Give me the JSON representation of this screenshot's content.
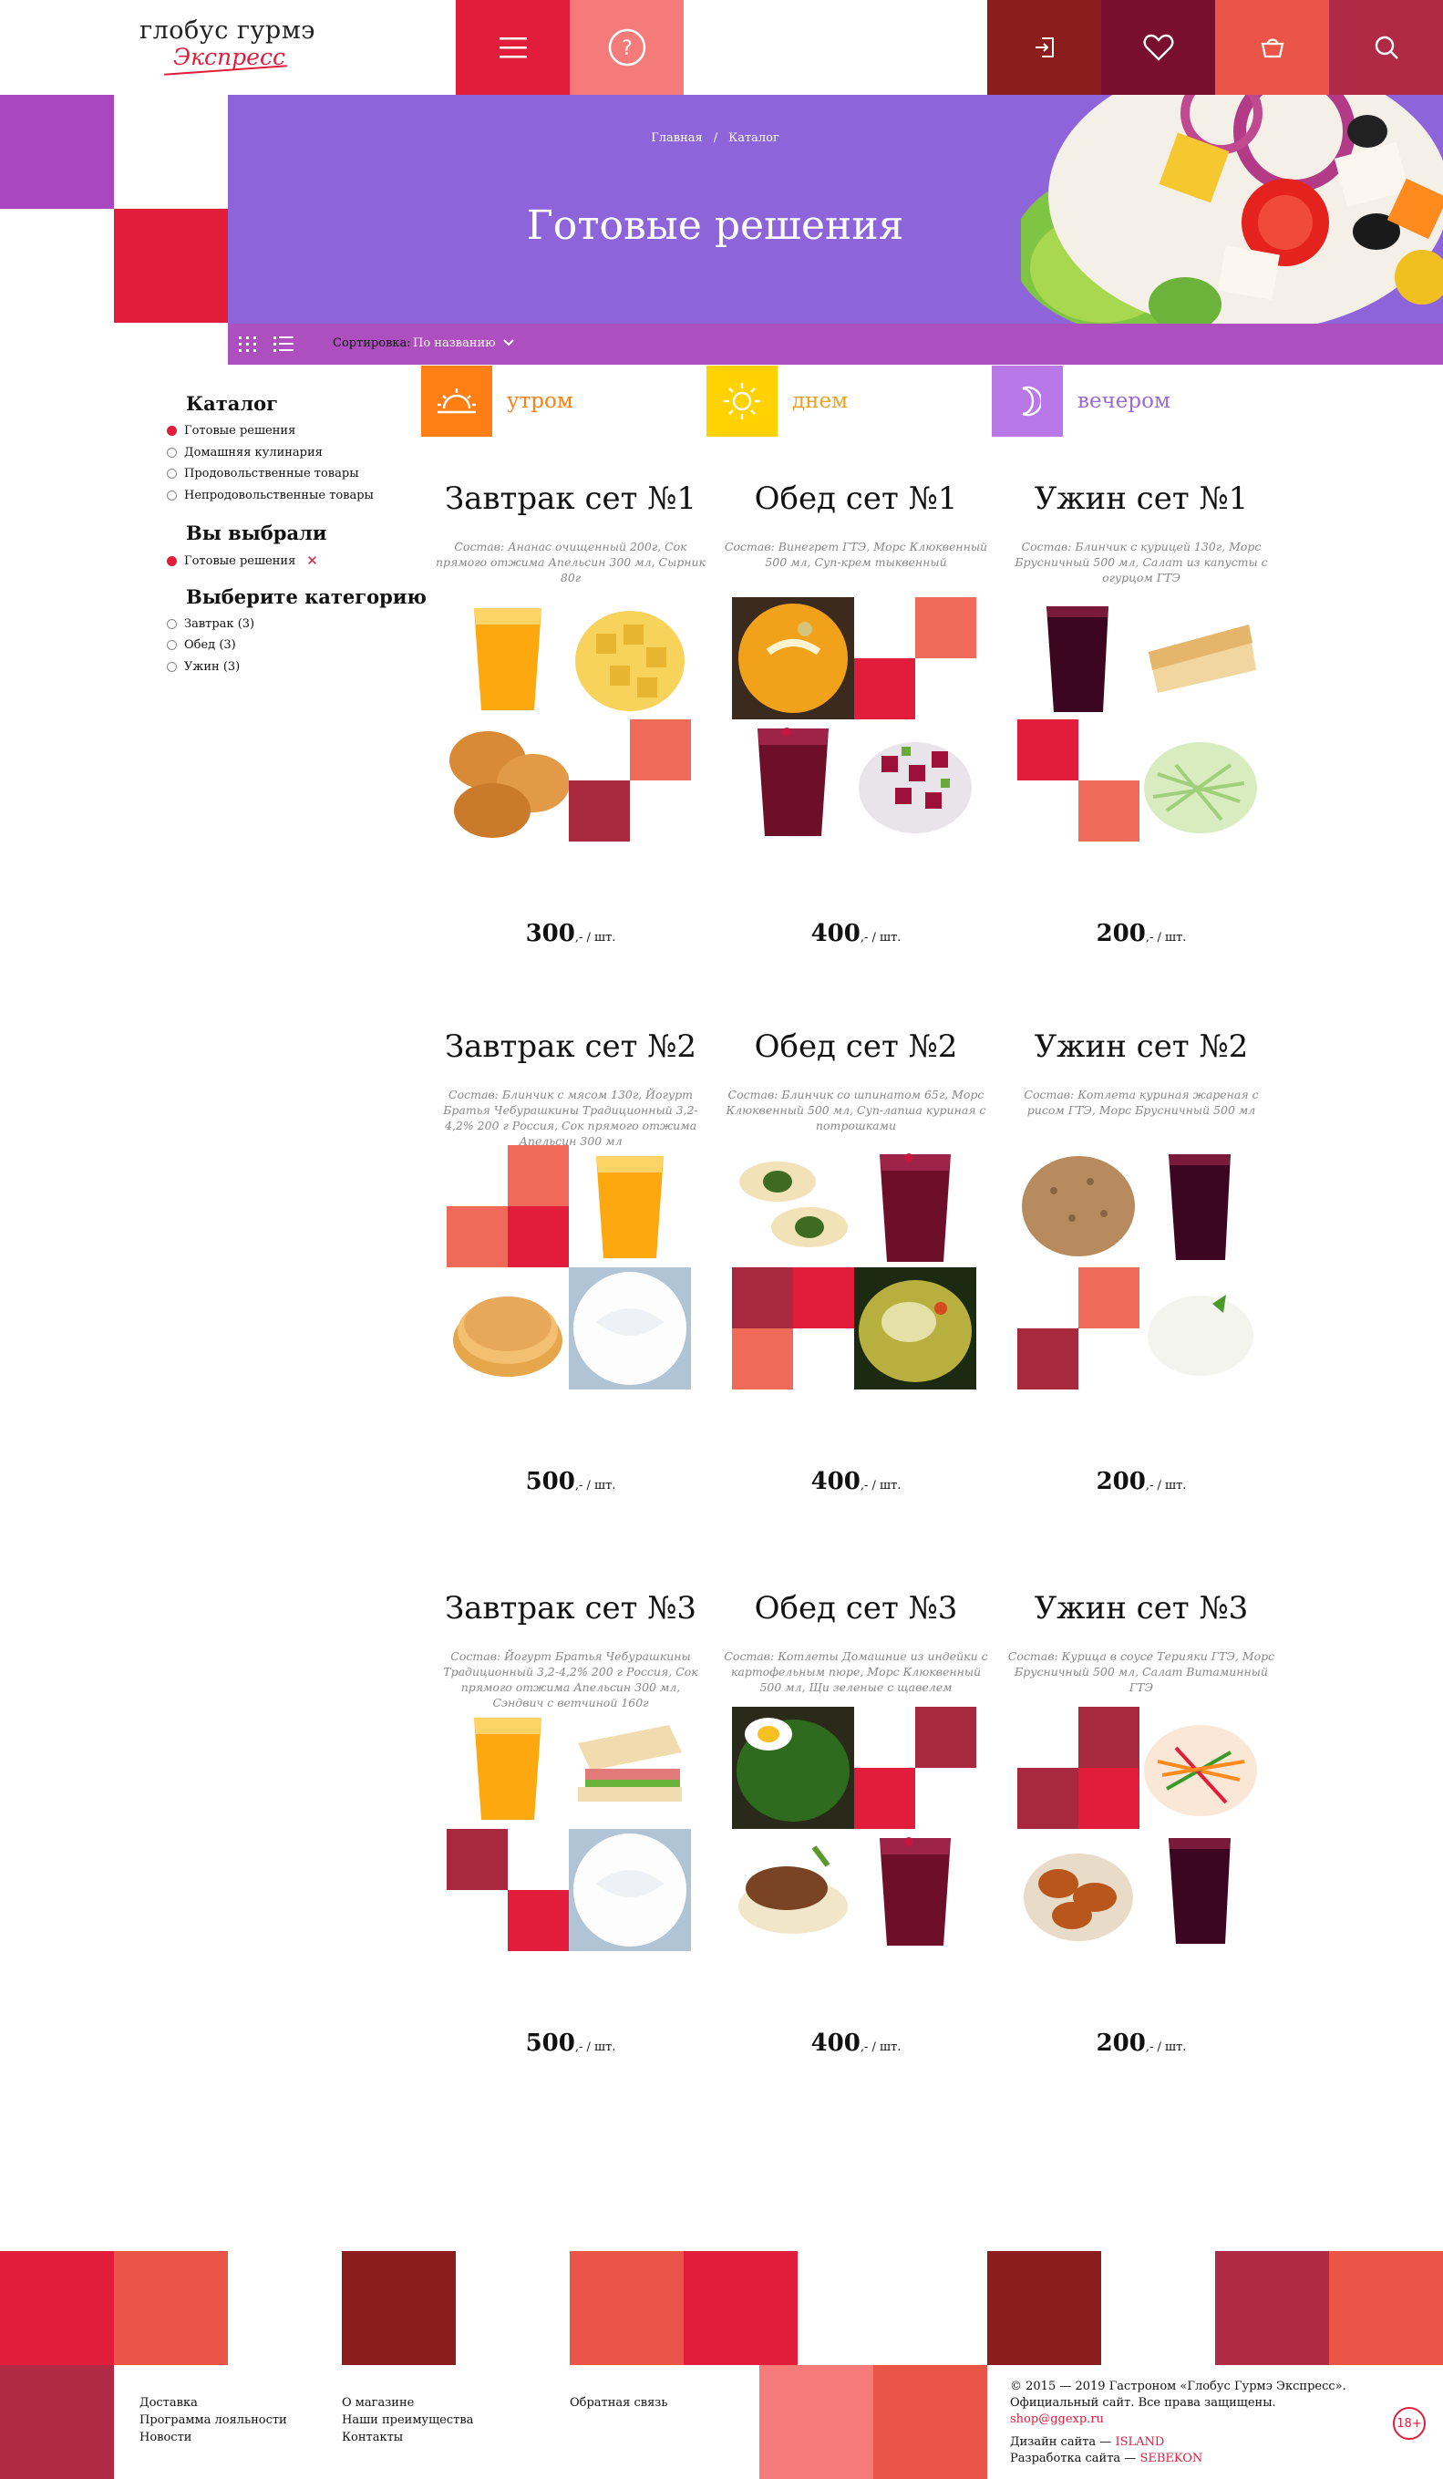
{
  "header": {
    "logo_line1": "глобус гурмэ",
    "logo_line2": "Экспресс",
    "colors": {
      "menu": "#e21d3c",
      "help": "#f57b7b",
      "login": "#8c1d1d",
      "fav": "#7a0e2f",
      "cart": "#ea5548",
      "search": "#b02a46"
    },
    "icons": [
      "menu-icon",
      "help-icon",
      "login-icon",
      "heart-icon",
      "cart-icon",
      "search-icon"
    ]
  },
  "breadcrumb": {
    "home": "Главная",
    "sep": "/",
    "current": "Каталог"
  },
  "banner": {
    "title": "Готовые решения",
    "color": "#8e64da"
  },
  "sortbar": {
    "label": "Сортировка:",
    "value": "По названию",
    "color": "#ad4fbf"
  },
  "sidebar": {
    "catalog_title": "Каталог",
    "catalog_items": [
      {
        "label": "Готовые решения",
        "active": true
      },
      {
        "label": "Домашняя кулинария",
        "active": false
      },
      {
        "label": "Продовольственные товары",
        "active": false
      },
      {
        "label": "Непродовольственные товары",
        "active": false
      }
    ],
    "selected_title": "Вы выбрали",
    "selected_items": [
      {
        "label": "Готовые решения"
      }
    ],
    "category_title": "Выберите категорию",
    "category_items": [
      {
        "label": "Завтрак (3)"
      },
      {
        "label": "Обед (3)"
      },
      {
        "label": "Ужин (3)"
      }
    ]
  },
  "time_tabs": [
    {
      "label": "утром",
      "color": "#ff7f14",
      "text_color": "#ff7f14",
      "icon": "sunrise-icon"
    },
    {
      "label": "днем",
      "color": "#ffd200",
      "text_color": "#f0a020",
      "icon": "sun-icon"
    },
    {
      "label": "вечером",
      "color": "#b878e8",
      "text_color": "#9c6ad8",
      "icon": "moon-icon"
    }
  ],
  "products": [
    {
      "title": "Завтрак сет №1",
      "desc": "Состав: Ананас очищенный 200г, Сок прямого отжима Апельсин 300 мл, Сырник 80г",
      "price": "300",
      "unit": ",- / шт."
    },
    {
      "title": "Обед сет №1",
      "desc": "Состав: Винегрет ГТЭ, Морс Клюквенный 500 мл, Суп-крем тыквенный",
      "price": "400",
      "unit": ",- / шт."
    },
    {
      "title": "Ужин сет №1",
      "desc": "Состав: Блинчик с курицей 130г, Морс Брусничный 500 мл, Салат из капусты с огурцом ГТЭ",
      "price": "200",
      "unit": ",- / шт."
    },
    {
      "title": "Завтрак сет №2",
      "desc": "Состав: Блинчик с мясом 130г, Йогурт Братья Чебурашкины Традиционный 3,2-4,2% 200 г Россия, Сок прямого отжима Апельсин 300 мл",
      "price": "500",
      "unit": ",- / шт."
    },
    {
      "title": "Обед сет №2",
      "desc": "Состав: Блинчик со шпинатом 65г, Морс Клюквенный 500 мл, Суп-лапша куриная с потрошками",
      "price": "400",
      "unit": ",- / шт."
    },
    {
      "title": "Ужин сет №2",
      "desc": "Состав: Котлета куриная жареная с рисом ГТЭ, Морс Брусничный 500 мл",
      "price": "200",
      "unit": ",- / шт."
    },
    {
      "title": "Завтрак сет №3",
      "desc": "Состав: Йогурт Братья Чебурашкины Традиционный 3,2-4,2% 200 г Россия, Сок прямого отжима Апельсин 300 мл, Сэндвич с ветчиной 160г",
      "price": "500",
      "unit": ",- / шт."
    },
    {
      "title": "Обед сет №3",
      "desc": "Состав: Котлеты Домашние из индейки с картофельным пюре, Морс Клюквенный 500 мл, Щи зеленые с щавелем",
      "price": "400",
      "unit": ",- / шт."
    },
    {
      "title": "Ужин сет №3",
      "desc": "Состав: Курица в соусе Терияки ГТЭ, Морс Брусничный 500 мл, Салат Витаминный ГТЭ",
      "price": "200",
      "unit": ",- / шт."
    }
  ],
  "footer": {
    "col1": [
      "Доставка",
      "Программа лояльности",
      "Новости"
    ],
    "col2": [
      "О магазине",
      "Наши преимущества",
      "Контакты"
    ],
    "col3": [
      "Обратная связь"
    ],
    "copyright": "© 2015 — 2019 Гастроном «Глобус Гурмэ Экспресс».",
    "official": "Официальный сайт. Все права защищены.",
    "email": "shop@ggexp.ru",
    "design_label": "Дизайн сайта —",
    "design_name": "ISLAND",
    "dev_label": "Разработка сайта —",
    "dev_name": "SEBEKON",
    "age": "18+"
  }
}
